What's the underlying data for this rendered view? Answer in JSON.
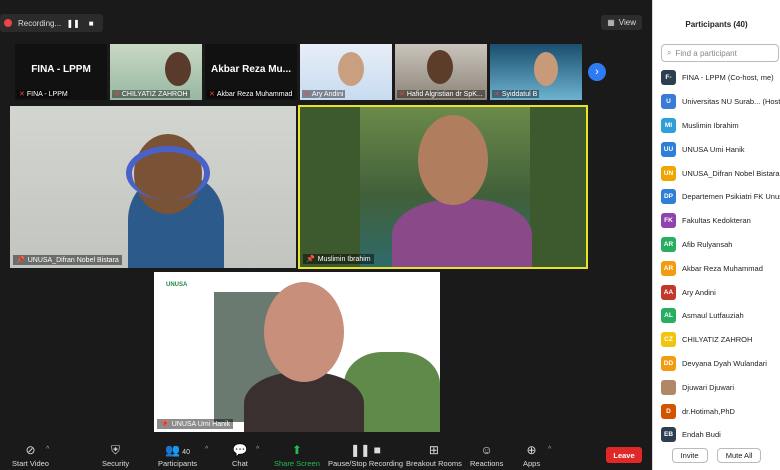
{
  "window": {
    "recording_label": "Recording...",
    "view_label": "View"
  },
  "filmstrip": [
    {
      "big_name": "FINA - LPPM",
      "caption": "FINA - LPPM"
    },
    {
      "big_name": "",
      "caption": "CHILYATIZ ZAHROH"
    },
    {
      "big_name": "Akbar Reza Mu...",
      "caption": "Akbar Reza Muhammad"
    },
    {
      "big_name": "",
      "caption": "Ary Andini"
    },
    {
      "big_name": "",
      "caption": "Hafid Algristian dr SpK..."
    },
    {
      "big_name": "",
      "caption": "Syiddatul B"
    }
  ],
  "tiles": {
    "left": {
      "caption": "UNUSA_Difran Nobel Bistara"
    },
    "right": {
      "caption": "Muslimin Ibrahim"
    },
    "bottom": {
      "caption": "UNUSA Umi Hanik",
      "banner_text": "UNUSA"
    }
  },
  "participants_panel": {
    "title": "Participants (40)",
    "search_placeholder": "Find a participant",
    "items": [
      {
        "initials": "F-",
        "name": "FINA - LPPM (Co-host, me)",
        "color": "#2d3e50"
      },
      {
        "initials": "U",
        "name": "Universitas NU Surab... (Host)",
        "color": "#3a7bd5"
      },
      {
        "initials": "MI",
        "name": "Muslimin Ibrahim",
        "color": "#2f9fd8"
      },
      {
        "initials": "UU",
        "name": "UNUSA Umi Hanik",
        "color": "#2f7fd8"
      },
      {
        "initials": "UN",
        "name": "UNUSA_Difran Nobel Bistara",
        "color": "#f0a500"
      },
      {
        "initials": "DP",
        "name": "Departemen Psikiatri FK Unusa",
        "color": "#2f7fd8"
      },
      {
        "initials": "FK",
        "name": "Fakultas Kedokteran",
        "color": "#8e44ad"
      },
      {
        "initials": "AR",
        "name": "Afib Rulyansah",
        "color": "#27ae60"
      },
      {
        "initials": "AR",
        "name": "Akbar Reza Muhammad",
        "color": "#f39c12"
      },
      {
        "initials": "AA",
        "name": "Ary Andini",
        "color": "#c0392b"
      },
      {
        "initials": "AL",
        "name": "Asmaul Lutfauziah",
        "color": "#27ae60"
      },
      {
        "initials": "CZ",
        "name": "CHILYATIZ ZAHROH",
        "color": "#f1c40f"
      },
      {
        "initials": "DD",
        "name": "Devyana Dyah Wulandari",
        "color": "#f39c12"
      },
      {
        "initials": "",
        "name": "Djuwari Djuwari",
        "color": "#b08868"
      },
      {
        "initials": "D",
        "name": "dr.Hotimah,PhD",
        "color": "#d35400"
      },
      {
        "initials": "EB",
        "name": "Endah Budi",
        "color": "#2c3e50"
      }
    ],
    "invite_label": "Invite",
    "mute_all_label": "Mute All"
  },
  "toolbar": {
    "start_video": "Start Video",
    "security": "Security",
    "participants": "Participants",
    "participants_count": "40",
    "chat": "Chat",
    "share_screen": "Share Screen",
    "pause_stop_recording": "Pause/Stop Recording",
    "breakout_rooms": "Breakout Rooms",
    "reactions": "Reactions",
    "apps": "Apps",
    "leave": "Leave"
  }
}
